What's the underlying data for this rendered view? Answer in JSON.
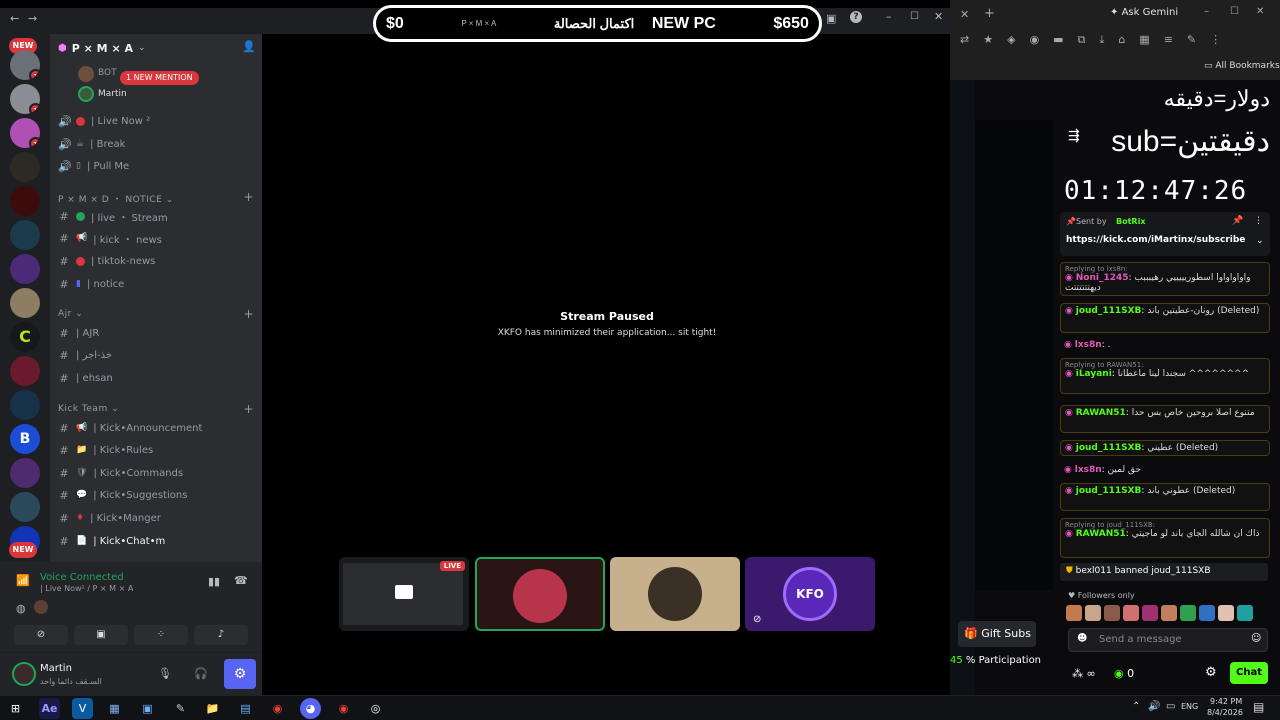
{
  "banner": {
    "left": "$0",
    "server_small": "P × M × A",
    "arabic": "اكتمال الحصالة",
    "title": "NEW PC",
    "right": "$650"
  },
  "servers": {
    "new_pill": "NEW",
    "badge": "1"
  },
  "channels": {
    "server_name": "P × M × A",
    "mention_pill": "1 NEW MENTION",
    "voice_members": [
      "BOT",
      "Martin"
    ],
    "voice": [
      {
        "label": "| Live Now ²",
        "icon": "speaker-icon"
      },
      {
        "label": "| Break",
        "icon": "speaker-icon"
      },
      {
        "label": "| Pull Me",
        "icon": "speaker-icon"
      }
    ],
    "notice_category": "P × M × D ・ NOTICE",
    "notice": [
      "| live ・ Stream",
      "| kick ・ news",
      "| tiktok-news",
      "| notice"
    ],
    "ajr_category": "Ajr",
    "ajr": [
      "| AJR",
      "| خذ-اجر",
      "| ehsan"
    ],
    "kick_category": "Kick Team",
    "kick": [
      "| Kick•Announcement",
      "| Kick•Rules",
      "| Kick•Commands",
      "| Kick•Suggestions",
      "| Kick•Manger",
      "| Kick•Chat•m"
    ]
  },
  "voice_connected": {
    "status": "Voice Connected",
    "channel": "| Live Now² / P × M × A"
  },
  "user": {
    "name": "Martin",
    "status": "السـقف دائما واحد"
  },
  "stream": {
    "title": "Stream Paused",
    "subtitle": "XKFO has minimized their application... sit tight!",
    "live_badge": "LIVE",
    "kfo_logo": "KFO"
  },
  "gemini": {
    "label": "Ask Gemini",
    "bookmarks": "All Bookmarks"
  },
  "overlay": {
    "line1": "دولار=دقيقه",
    "line2": "sub=دقيقتين",
    "timer": "01:12:47:26"
  },
  "pinned": {
    "sent_by": "Sent by",
    "bot": "BotRix",
    "link": "https://kick.com/iMartinx/subscribe"
  },
  "chat": [
    {
      "reply": "Replying to lxs8n:",
      "user": "Noni_1245",
      "text": "واواواواوا اسطوريييييي رهيبببب ديهتتتتتتت",
      "color": "#e05ab7"
    },
    {
      "user": "joud_111SXB",
      "text": "رونان-عطيتين باند (Deleted)",
      "color": "#53fc18"
    },
    {
      "user": "lxs8n",
      "text": ".",
      "color": "#e05ab7"
    },
    {
      "reply": "Replying to RAWAN51:",
      "user": "iLayani",
      "text": "سجندا لينا ماعطانا ^^^^^^^^",
      "color": "#53fc18"
    },
    {
      "user": "RAWAN51",
      "text": "متنوع اصلا بروحين خاص بس حدا",
      "color": "#53fc18"
    },
    {
      "user": "joud_111SXB",
      "text": "عطيني (Deleted)",
      "color": "#53fc18"
    },
    {
      "user": "lxs8n",
      "text": "حق لمين",
      "color": "#e05ab7"
    },
    {
      "user": "joud_111SXB",
      "text": "عطوني باند (Deleted)",
      "color": "#53fc18"
    },
    {
      "reply": "Replying to joud_111SXB:",
      "user": "RAWAN51",
      "text": "ذاك ان شالله الجاي باند لو ماجيتي",
      "color": "#53fc18"
    }
  ],
  "ban": {
    "text": "bexl011 banned joud_111SXB"
  },
  "followers": "Followers only",
  "send_placeholder": "Send a message",
  "gift_subs": "Gift Subs",
  "participation": "45 % Participation",
  "chat_button": "Chat",
  "points": "0",
  "infinity": "∞",
  "tray": {
    "lang": "ENG",
    "time": "9:42 PM",
    "date": "8/4/2026"
  }
}
